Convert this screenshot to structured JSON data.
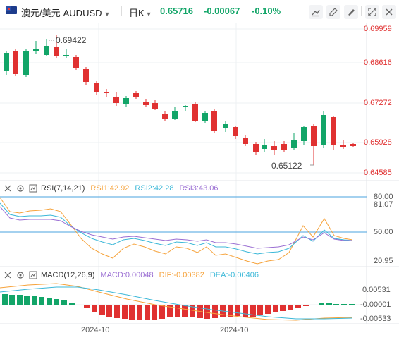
{
  "header": {
    "symbol_name": "澳元/美元",
    "symbol_code": "AUDUSD",
    "period": "日K",
    "last_price": "0.65716",
    "change": "-0.00067",
    "change_pct": "-0.10%",
    "price_color": "#12a568",
    "toolbar_icons": [
      "draw-tool-icon",
      "fullscreen-edit-icon",
      "pen-icon",
      "settings-icon",
      "expand-icon",
      "close-icon"
    ]
  },
  "main_chart": {
    "price_labels": [
      "0.69959",
      "0.68616",
      "0.67272",
      "0.65928",
      "0.64585"
    ],
    "high_marker": "0.69422",
    "low_marker": "0.65122",
    "up_color": "#12a568",
    "down_color": "#e03131"
  },
  "rsi": {
    "title": "RSI(7,14,21)",
    "rsi1": "RSI1:42.92",
    "rsi2": "RSI2:42.28",
    "rsi3": "RSI3:43.06",
    "rsi1_color": "#f6a23a",
    "rsi2_color": "#3cb8d8",
    "rsi3_color": "#9b6fd3",
    "axis_labels": [
      "80.00",
      "81.07",
      "50.00",
      "20.95"
    ]
  },
  "macd": {
    "title": "MACD(12,26,9)",
    "macd": "MACD:0.00048",
    "dif": "DIF:-0.00382",
    "dea": "DEA:-0.00406",
    "macd_color": "#9b6fd3",
    "dif_color": "#f6a23a",
    "dea_color": "#3cb8d8",
    "axis_labels": [
      "0.00531",
      "-0.00001",
      "-0.00533"
    ]
  },
  "x_axis": {
    "labels": [
      "2024-10",
      "2024-10"
    ]
  }
}
